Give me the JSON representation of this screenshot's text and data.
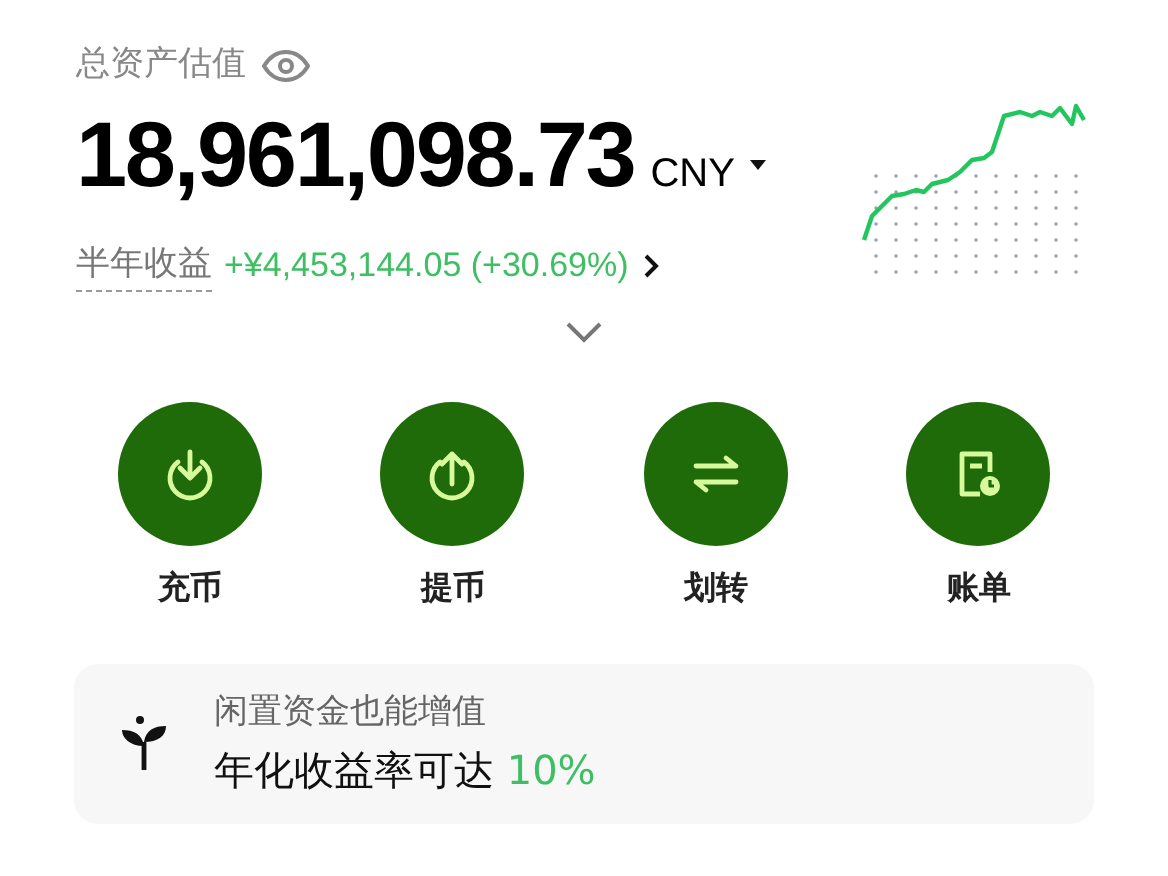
{
  "total": {
    "label": "总资产估值",
    "amount": "18,961,098.73",
    "currency": "CNY"
  },
  "profit": {
    "label": "半年收益",
    "value": "+¥4,453,144.05 (+30.69%)"
  },
  "actions": [
    {
      "kind": "deposit",
      "label": "充币"
    },
    {
      "kind": "withdraw",
      "label": "提币"
    },
    {
      "kind": "transfer",
      "label": "划转"
    },
    {
      "kind": "bill",
      "label": "账单"
    }
  ],
  "promo": {
    "title": "闲置资金也能增值",
    "text": "年化收益率可达",
    "highlight": "10%"
  }
}
